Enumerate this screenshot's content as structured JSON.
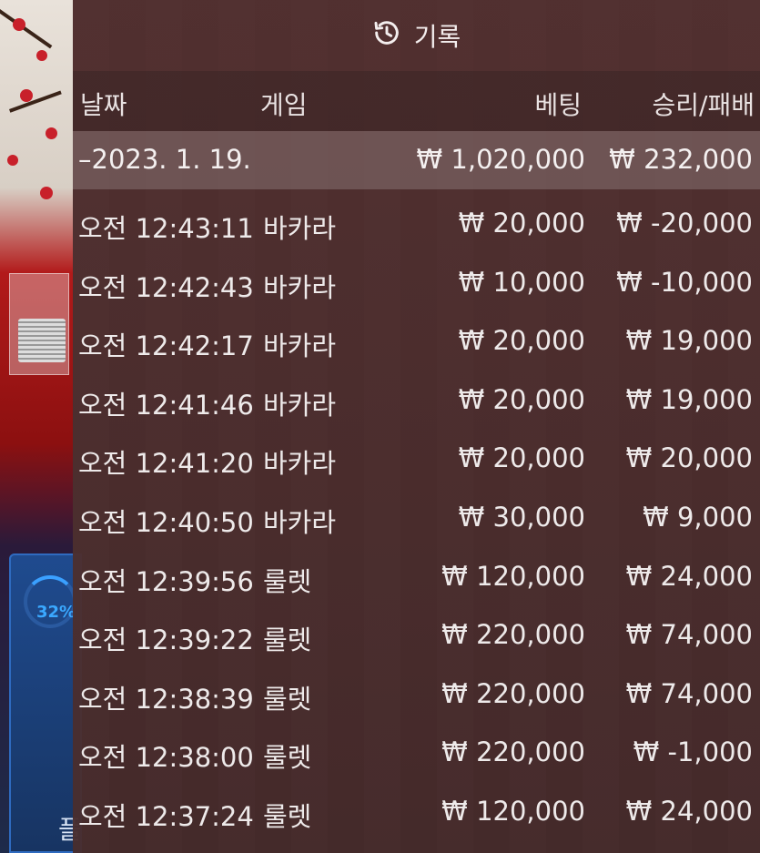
{
  "panel": {
    "title": "기록",
    "title_icon": "history-icon"
  },
  "columns": {
    "date": "날짜",
    "game": "게임",
    "bet": "베팅",
    "winloss": "승리/패배"
  },
  "summary": {
    "date": "–2023. 1. 19.",
    "bet": "₩ 1,020,000",
    "winloss": "₩ 232,000"
  },
  "rows": [
    {
      "time": "오전 12:43:11",
      "game": "바카라",
      "bet": "₩ 20,000",
      "winloss": "₩ -20,000"
    },
    {
      "time": "오전 12:42:43",
      "game": "바카라",
      "bet": "₩ 10,000",
      "winloss": "₩ -10,000"
    },
    {
      "time": "오전 12:42:17",
      "game": "바카라",
      "bet": "₩ 20,000",
      "winloss": "₩ 19,000"
    },
    {
      "time": "오전 12:41:46",
      "game": "바카라",
      "bet": "₩ 20,000",
      "winloss": "₩ 19,000"
    },
    {
      "time": "오전 12:41:20",
      "game": "바카라",
      "bet": "₩ 20,000",
      "winloss": "₩ 20,000"
    },
    {
      "time": "오전 12:40:50",
      "game": "바카라",
      "bet": "₩ 30,000",
      "winloss": "₩ 9,000"
    },
    {
      "time": "오전 12:39:56",
      "game": "룰렛",
      "bet": "₩ 120,000",
      "winloss": "₩ 24,000"
    },
    {
      "time": "오전 12:39:22",
      "game": "룰렛",
      "bet": "₩ 220,000",
      "winloss": "₩ 74,000"
    },
    {
      "time": "오전 12:38:39",
      "game": "룰렛",
      "bet": "₩ 220,000",
      "winloss": "₩ 74,000"
    },
    {
      "time": "오전 12:38:00",
      "game": "룰렛",
      "bet": "₩ 220,000",
      "winloss": "₩ -1,000"
    },
    {
      "time": "오전 12:37:24",
      "game": "룰렛",
      "bet": "₩ 120,000",
      "winloss": "₩ 24,000"
    }
  ],
  "background": {
    "progress_text": "32%",
    "bottom_glyph": "플"
  },
  "colors": {
    "panel_bg": "#482c2c",
    "summary_bg": "#786060",
    "text": "#eeeaea",
    "progress_blue": "#3aa8ff"
  }
}
